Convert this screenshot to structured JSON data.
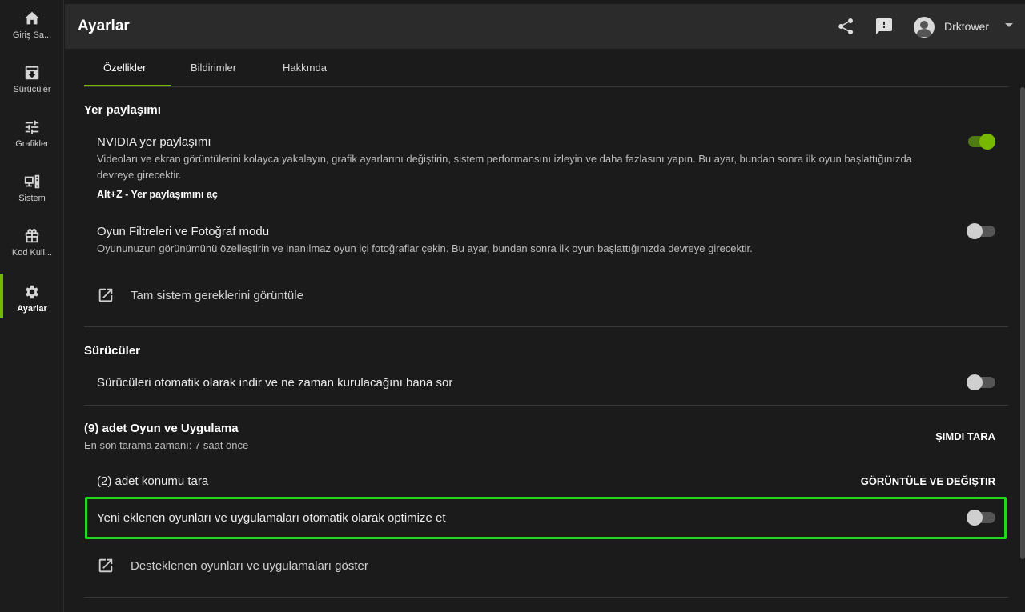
{
  "sidebar": {
    "items": [
      {
        "label": "Giriş Sa...",
        "icon": "home-icon"
      },
      {
        "label": "Sürücüler",
        "icon": "download-icon"
      },
      {
        "label": "Grafikler",
        "icon": "sliders-icon"
      },
      {
        "label": "Sistem",
        "icon": "monitor-icon"
      },
      {
        "label": "Kod Kull...",
        "icon": "gift-icon"
      },
      {
        "label": "Ayarlar",
        "icon": "gear-icon",
        "active": true
      }
    ]
  },
  "header": {
    "title": "Ayarlar",
    "share_icon": "share-icon",
    "feedback_icon": "feedback-icon",
    "username": "Drktower"
  },
  "tabs": [
    {
      "label": "Özellikler",
      "active": true
    },
    {
      "label": "Bildirimler"
    },
    {
      "label": "Hakkında"
    }
  ],
  "overlay": {
    "title": "Yer paylaşımı",
    "nvidia": {
      "title": "NVIDIA yer paylaşımı",
      "desc": "Videoları ve ekran görüntülerini kolayca yakalayın, grafik ayarlarını değiştirin, sistem performansını izleyin ve daha fazlasını yapın. Bu ayar, bundan sonra ilk oyun başlattığınızda devreye girecektir.",
      "hotkey": "Alt+Z - Yer paylaşımını aç",
      "enabled": true
    },
    "filters": {
      "title": "Oyun Filtreleri ve Fotoğraf modu",
      "desc": "Oyununuzun görünümünü özelleştirin ve inanılmaz oyun içi fotoğraflar çekin. Bu ayar, bundan sonra ilk oyun başlattığınızda devreye girecektir.",
      "enabled": false
    },
    "requirements_link": "Tam sistem gereklerini görüntüle"
  },
  "drivers": {
    "title": "Sürücüler",
    "auto_download": "Sürücüleri otomatik olarak indir ve ne zaman kurulacağını bana sor",
    "enabled": false
  },
  "games": {
    "title": "(9) adet Oyun ve Uygulama",
    "last_scan": "En son tarama zamanı: 7 saat önce",
    "scan_now": "ŞIMDI TARA",
    "locations": "(2) adet konumu tara",
    "view_change": "GÖRÜNTÜLE VE DEĞIŞTIR",
    "auto_optimize": "Yeni eklenen oyunları ve uygulamaları otomatik olarak optimize et",
    "auto_optimize_enabled": false,
    "supported_link": "Desteklenen oyunları ve uygulamaları göster"
  },
  "colors": {
    "accent": "#76b900",
    "highlight": "#1fd81f"
  }
}
